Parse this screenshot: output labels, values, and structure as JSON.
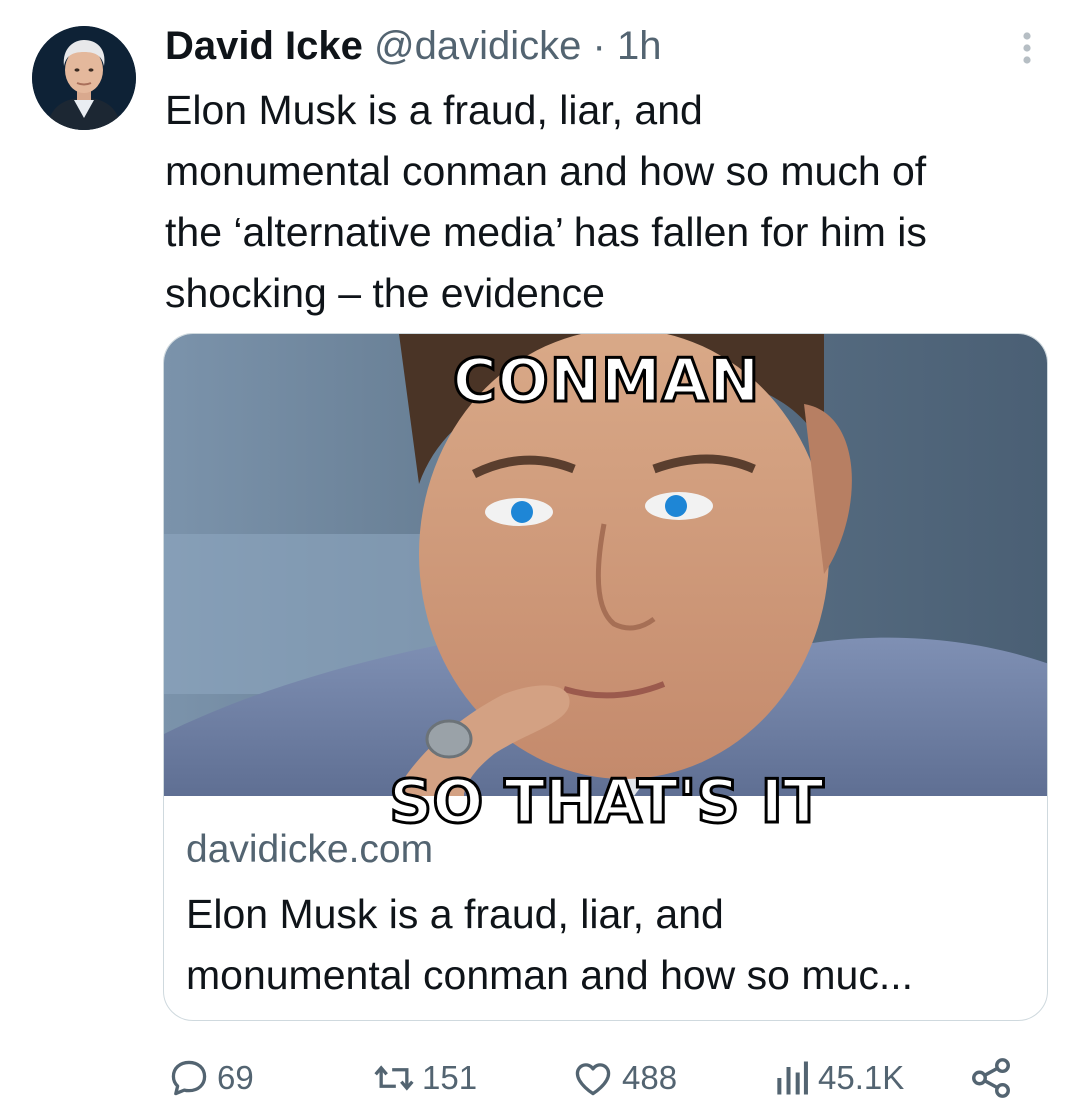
{
  "author": {
    "name": "David Icke",
    "handle": "@davidicke",
    "separator": "·",
    "time": "1h"
  },
  "tweet": {
    "text": "Elon Musk is a fraud, liar, and\nmonumental conman and how so much of\nthe ‘alternative media’ has fallen for him is\nshocking – the evidence"
  },
  "card": {
    "image_caption_top": "CONMAN",
    "image_caption_bottom": "SO THAT'S IT",
    "domain": "davidicke.com",
    "title": "Elon Musk is a fraud, liar, and\nmonumental conman and how so muc..."
  },
  "actions": {
    "replies": "69",
    "reposts": "151",
    "likes": "488",
    "views": "45.1K"
  },
  "icons": {
    "more": "more-vertical-icon",
    "reply": "reply-icon",
    "repost": "repost-icon",
    "like": "heart-icon",
    "views": "views-chart-icon",
    "share": "share-icon"
  },
  "colors": {
    "text": "#0f1419",
    "secondary": "#536471",
    "border": "#cfd9de"
  }
}
